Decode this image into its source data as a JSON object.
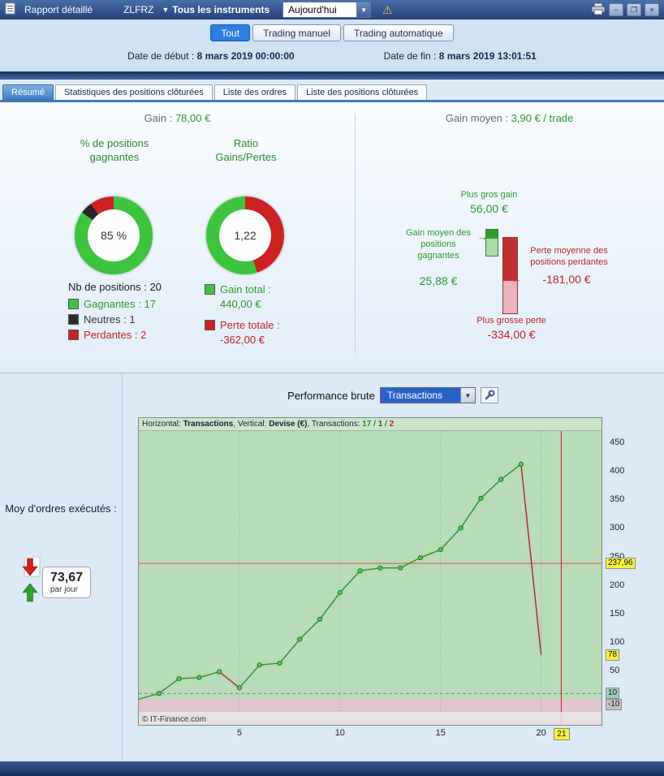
{
  "titlebar": {
    "title": "Rapport détaillé",
    "instrument": "ZLFRZ",
    "instruments_dropdown": "Tous les instruments",
    "period_select": "Aujourd'hui"
  },
  "icons": {
    "dropdown_arrow": "▼",
    "combo_arrow": "▼",
    "minimize": "–",
    "maximize": "❐",
    "close": "×",
    "warning": "⚠",
    "arrow_right": "→",
    "arrow_left": "←"
  },
  "mode_tabs": [
    "Tout",
    "Trading manuel",
    "Trading automatique"
  ],
  "dates": {
    "start_label": "Date de début :",
    "start_value": "8 mars 2019 00:00:00",
    "end_label": "Date de fin :",
    "end_value": "8 mars 2019 13:01:51"
  },
  "report_tabs": [
    "Résumé",
    "Statistiques des positions clôturées",
    "Liste des ordres",
    "Liste des positions clôturées"
  ],
  "summary": {
    "gain_label": "Gain : ",
    "gain_value": "78,00 €",
    "winpct_title": "% de positions gagnantes",
    "winpct_value": "85 %",
    "ratio_title": "Ratio Gains/Pertes",
    "ratio_value": "1,22",
    "nb_positions": "Nb de positions : 20",
    "legend": [
      {
        "label": "Gagnantes : 17",
        "color": "#3ec43e"
      },
      {
        "label": "Neutres : 1",
        "color": "#2b2b2b"
      },
      {
        "label": "Perdantes : 2",
        "color": "#cc2222"
      }
    ],
    "gain_total_label": "Gain total :",
    "gain_total_value": "440,00 €",
    "perte_totale_label": "Perte totale :",
    "perte_totale_value": "-362,00 €",
    "gain_moyen_label": "Gain moyen : ",
    "gain_moyen_value": "3,90 € / trade",
    "plus_gros_gain_label": "Plus gros gain",
    "plus_gros_gain_value": "56,00 €",
    "gain_moyen_gagnantes_label": "Gain moyen des positions gagnantes",
    "gain_moyen_gagnantes_value": "25,88 €",
    "perte_moyenne_label": "Perte moyenne des positions perdantes",
    "perte_moyenne_value": "-181,00 €",
    "plus_grosse_perte_label": "Plus grosse perte",
    "plus_grosse_perte_value": "-334,00 €"
  },
  "donut_win": {
    "segments": [
      {
        "color": "#3ec43e",
        "pct": 85
      },
      {
        "color": "#262626",
        "pct": 5
      },
      {
        "color": "#cc2222",
        "pct": 10
      }
    ]
  },
  "donut_ratio": {
    "segments": [
      {
        "color": "#cc2222",
        "pct": 45
      },
      {
        "color": "#3ec43e",
        "pct": 55
      }
    ]
  },
  "orders": {
    "title": "Moy d'ordres exécutés :",
    "value": "73,67",
    "unit": "par jour"
  },
  "performance": {
    "label": "Performance brute",
    "dropdown_value": "Transactions"
  },
  "status_text": "",
  "chart_data": {
    "type": "line",
    "title": "Performance brute",
    "header": {
      "horizontal_label": "Horizontal: ",
      "horizontal_value": "Transactions",
      "vertical_label": ", Vertical: ",
      "vertical_value": "Devise (€)",
      "counts_label": ", Transactions: ",
      "wins": "17",
      "sep1": " / ",
      "neutral": "1",
      "sep2": " / ",
      "losses": "2"
    },
    "x": [
      0,
      1,
      2,
      3,
      4,
      5,
      6,
      7,
      8,
      9,
      10,
      11,
      12,
      13,
      14,
      15,
      16,
      17,
      18,
      19,
      20
    ],
    "values": [
      0,
      10,
      36,
      38,
      48,
      20,
      60,
      63,
      105,
      140,
      187,
      225,
      230,
      230,
      248,
      262,
      300,
      352,
      385,
      412,
      78
    ],
    "xlim": [
      0,
      23
    ],
    "ylim": [
      -45,
      470
    ],
    "yticks": [
      450,
      400,
      350,
      300,
      250,
      200,
      150,
      100,
      50
    ],
    "special_yticks": [
      {
        "value": 237.96,
        "label": "237,96",
        "bg": "#f7f23e"
      },
      {
        "value": 78,
        "label": "78",
        "bg": "#f7f23e"
      },
      {
        "value": 10,
        "label": "10",
        "bg": "#9ccfbf"
      },
      {
        "value": -10,
        "label": "-10",
        "bg": "#c4c4c4"
      }
    ],
    "xticks": [
      5,
      10,
      15,
      20
    ],
    "cursor": {
      "x": 21,
      "label": "21",
      "bg": "#f7f23e"
    },
    "avg_line": 237.96,
    "dashed_line": 10,
    "colors": {
      "up": "#2e8b2e",
      "down": "#b22222",
      "marker": "#55c855",
      "marker_edge": "#1f7a1f",
      "plot_bg": "#b7dcb7",
      "neg_bg": "#e3c3cd",
      "grid": "#8fa98f",
      "avg_line": "#d06868",
      "cursor_line": "#cc2222"
    },
    "copyright": "© IT-Finance.com",
    "legend_position": "none",
    "grid": "vertical-dotted"
  }
}
